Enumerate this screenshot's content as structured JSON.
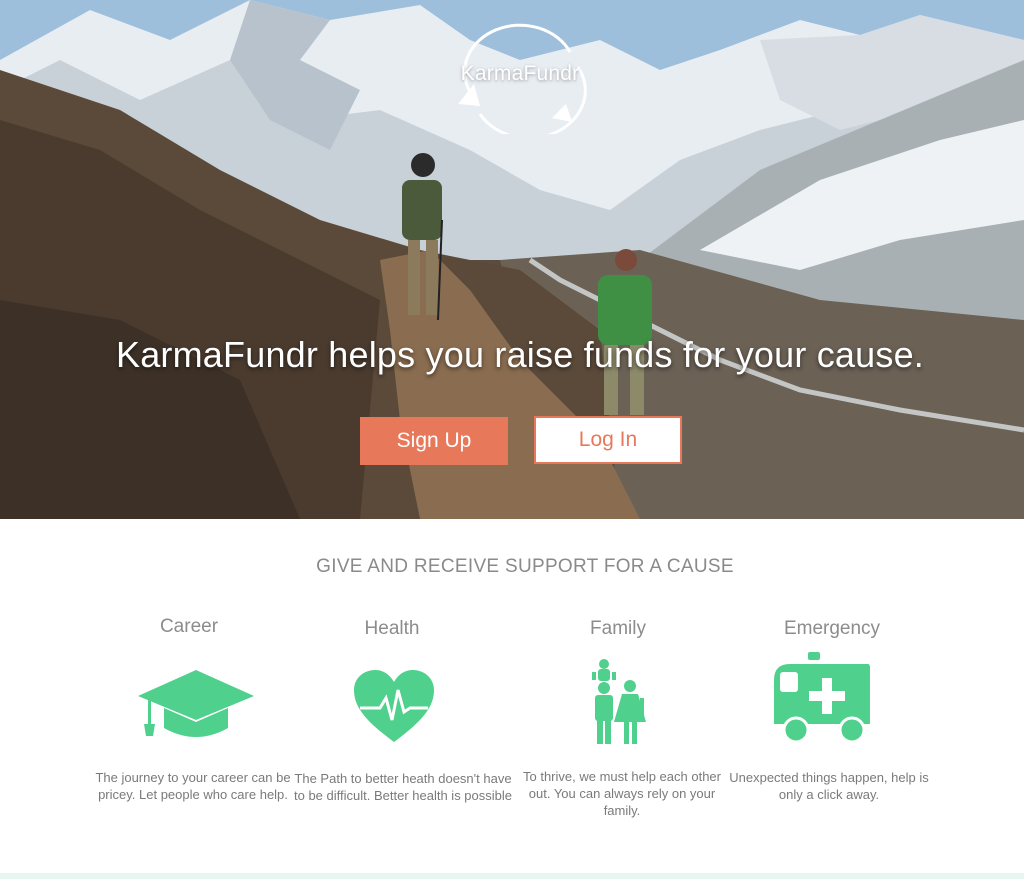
{
  "brand": {
    "logo_text": "KarmaFundr"
  },
  "hero": {
    "headline": "KarmaFundr  helps you raise funds for your cause.",
    "signup_label": "Sign Up",
    "login_label": "Log In"
  },
  "features": {
    "section_title": "GIVE AND RECEIVE SUPPORT FOR A CAUSE",
    "items": [
      {
        "title": "Career",
        "icon": "graduation-cap-icon",
        "description": "The journey to your career can be pricey. Let people who care help."
      },
      {
        "title": "Health",
        "icon": "heartbeat-icon",
        "description": "The Path to better heath doesn't have to be difficult. Better health is possible"
      },
      {
        "title": "Family",
        "icon": "family-icon",
        "description": "To thrive, we must help each other out. You can always rely on your family."
      },
      {
        "title": "Emergency",
        "icon": "ambulance-icon",
        "description": "Unexpected things happen, help is only a click away."
      }
    ]
  },
  "colors": {
    "accent": "#e8785a",
    "icon_green": "#4fd08c",
    "text_gray": "#8a8a8a"
  }
}
